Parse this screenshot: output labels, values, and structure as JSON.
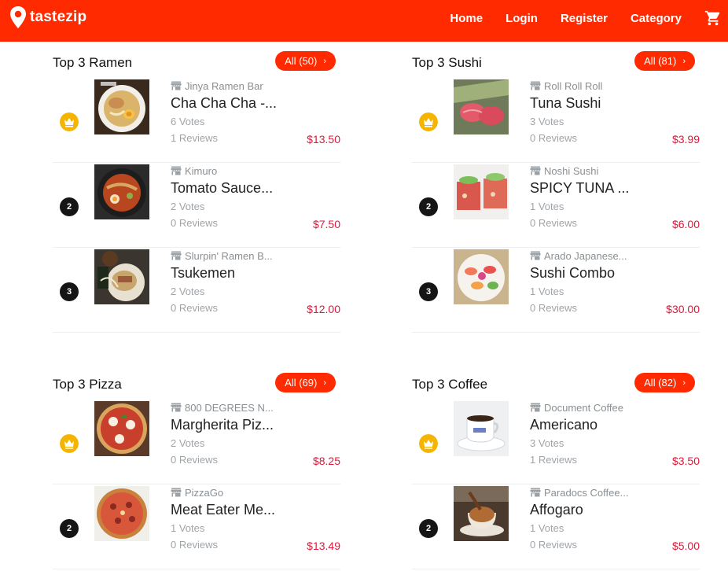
{
  "brand": {
    "name": "tastezip",
    "color": "#ff2a00"
  },
  "nav": {
    "home": "Home",
    "login": "Login",
    "register": "Register",
    "category": "Category"
  },
  "sections": [
    {
      "title": "Top 3 Ramen",
      "all": "All (50)",
      "items": [
        {
          "rank": "crown",
          "store": "Jinya Ramen Bar",
          "dish": "Cha Cha Cha -...",
          "votes": "6 Votes",
          "reviews": "1 Reviews",
          "price": "$13.50"
        },
        {
          "rank": "2",
          "store": "Kimuro",
          "dish": "Tomato Sauce...",
          "votes": "2 Votes",
          "reviews": "0 Reviews",
          "price": "$7.50"
        },
        {
          "rank": "3",
          "store": "Slurpin' Ramen B...",
          "dish": "Tsukemen",
          "votes": "2 Votes",
          "reviews": "0 Reviews",
          "price": "$12.00"
        }
      ]
    },
    {
      "title": "Top 3 Sushi",
      "all": "All (81)",
      "items": [
        {
          "rank": "crown",
          "store": "Roll Roll Roll",
          "dish": "Tuna Sushi",
          "votes": "3 Votes",
          "reviews": "0 Reviews",
          "price": "$3.99"
        },
        {
          "rank": "2",
          "store": "Noshi Sushi",
          "dish": "SPICY TUNA ...",
          "votes": "1 Votes",
          "reviews": "0 Reviews",
          "price": "$6.00"
        },
        {
          "rank": "3",
          "store": "Arado Japanese...",
          "dish": "Sushi Combo",
          "votes": "1 Votes",
          "reviews": "0 Reviews",
          "price": "$30.00"
        }
      ]
    },
    {
      "title": "Top 3 Pizza",
      "all": "All (69)",
      "items": [
        {
          "rank": "crown",
          "store": "800 DEGREES N...",
          "dish": "Margherita Piz...",
          "votes": "2 Votes",
          "reviews": "0 Reviews",
          "price": "$8.25"
        },
        {
          "rank": "2",
          "store": "PizzaGo",
          "dish": "Meat Eater Me...",
          "votes": "1 Votes",
          "reviews": "0 Reviews",
          "price": "$13.49"
        }
      ]
    },
    {
      "title": "Top 3 Coffee",
      "all": "All (82)",
      "items": [
        {
          "rank": "crown",
          "store": "Document Coffee",
          "dish": "Americano",
          "votes": "3 Votes",
          "reviews": "1 Reviews",
          "price": "$3.50"
        },
        {
          "rank": "2",
          "store": "Paradocs Coffee...",
          "dish": "Affogaro",
          "votes": "1 Votes",
          "reviews": "0 Reviews",
          "price": "$5.00"
        }
      ]
    }
  ]
}
